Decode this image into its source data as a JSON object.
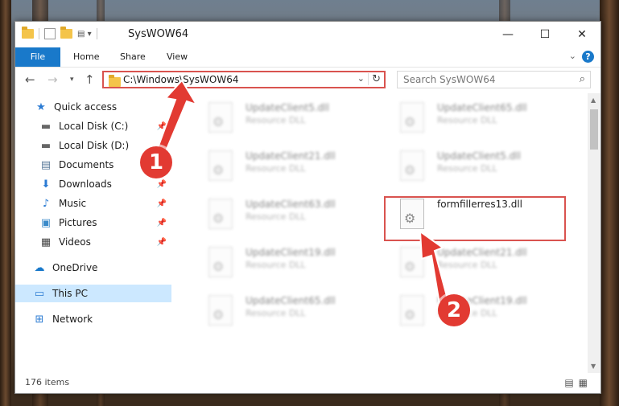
{
  "window": {
    "title": "SysWOW64"
  },
  "ribbon": {
    "tabs": [
      "File",
      "Home",
      "Share",
      "View"
    ]
  },
  "address": {
    "path": "C:\\Windows\\SysWOW64"
  },
  "search": {
    "placeholder": "Search SysWOW64"
  },
  "sidebar": {
    "items": [
      {
        "label": "Quick access",
        "icon": "star-icon"
      },
      {
        "label": "Local Disk (C:)",
        "icon": "disk-icon"
      },
      {
        "label": "Local Disk (D:)",
        "icon": "disk-icon"
      },
      {
        "label": "Documents",
        "icon": "documents-icon"
      },
      {
        "label": "Downloads",
        "icon": "downloads-icon"
      },
      {
        "label": "Music",
        "icon": "music-icon"
      },
      {
        "label": "Pictures",
        "icon": "pictures-icon"
      },
      {
        "label": "Videos",
        "icon": "videos-icon"
      },
      {
        "label": "OneDrive",
        "icon": "cloud-icon"
      },
      {
        "label": "This PC",
        "icon": "computer-icon"
      },
      {
        "label": "Network",
        "icon": "network-icon"
      }
    ]
  },
  "files": [
    {
      "name": "UpdateClient5.dll",
      "type": "Resource DLL"
    },
    {
      "name": "UpdateClient65.dll",
      "type": "Resource DLL"
    },
    {
      "name": "UpdateClient21.dll",
      "type": "Resource DLL"
    },
    {
      "name": "UpdateClient5.dll",
      "type": "Resource DLL"
    },
    {
      "name": "UpdateClient63.dll",
      "type": "Resource DLL"
    },
    {
      "name": "formfillerres13.dll",
      "type": ""
    },
    {
      "name": "UpdateClient19.dll",
      "type": "Resource DLL"
    },
    {
      "name": "UpdateClient21.dll",
      "type": "Resource DLL"
    },
    {
      "name": "UpdateClient65.dll",
      "type": "Resource DLL"
    },
    {
      "name": "UpdateClient19.dll",
      "type": "Resource DLL"
    }
  ],
  "status": {
    "item_count": "176 items"
  },
  "callouts": [
    "1",
    "2"
  ],
  "colors": {
    "accent": "#1979ca",
    "highlight": "#d9534f",
    "callout": "#e23a32"
  }
}
